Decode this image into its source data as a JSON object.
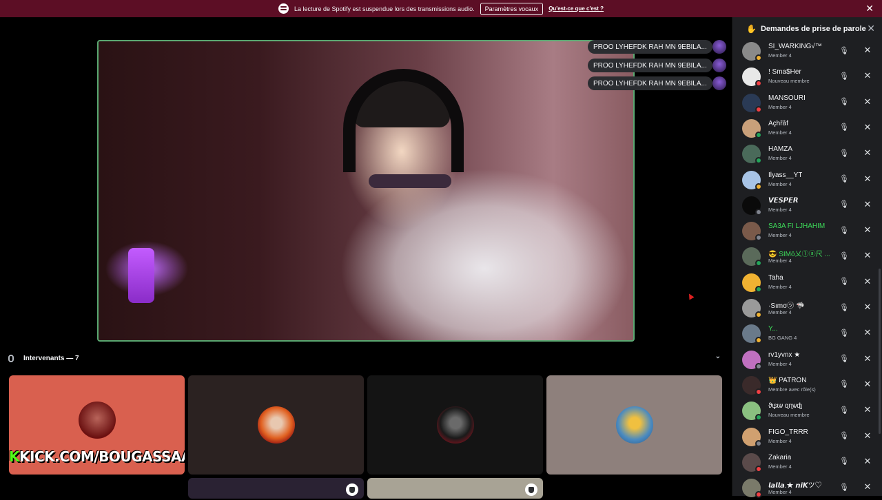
{
  "notice": {
    "message": "La lecture de Spotify est suspendue lors des transmissions audio.",
    "button_label": "Paramètres vocaux",
    "link_label": "Qu'est-ce que c'est ?",
    "close_glyph": "✕"
  },
  "stage": {
    "chat_messages": [
      "PROO LYHEFDK RAH MN 9EBILA...",
      "PROO LYHEFDK RAH MN 9EBILA...",
      "PROO LYHEFDK RAH MN 9EBILA..."
    ],
    "speakers_label": "Intervenants — 7",
    "chevron_glyph": "⌄",
    "kick_banner_k": "K",
    "kick_banner_text": "KICK.COM/BOUGASSAA"
  },
  "sidebar": {
    "title": "Demandes de prise de parole",
    "close_glyph": "✕",
    "accept_glyph": "🎙",
    "deny_glyph": "✕",
    "requests": [
      {
        "name": "SI_WARKING√™",
        "role": "Member 4",
        "status": "idle",
        "name_color": "#f2f3f5",
        "avatar": "#8a8a8a"
      },
      {
        "name": "! Sma$Her",
        "role": "Nouveau membre",
        "status": "dnd",
        "name_color": "#f2f3f5",
        "avatar": "#e8e8e8"
      },
      {
        "name": "MANSOURI",
        "role": "Member 4",
        "status": "dnd",
        "name_color": "#f2f3f5",
        "avatar": "#2a3a55"
      },
      {
        "name": "Açhřâf",
        "role": "Member 4",
        "status": "online",
        "name_color": "#f2f3f5",
        "avatar": "#c9a07a"
      },
      {
        "name": "HAMZA",
        "role": "Member 4",
        "status": "online",
        "name_color": "#f2f3f5",
        "avatar": "#4a6a5a"
      },
      {
        "name": "Ilyass__YT",
        "role": "Member 4",
        "status": "idle",
        "name_color": "#f2f3f5",
        "avatar": "#a8c4e6"
      },
      {
        "name": "𝙑𝙀𝙎𝙋𝙀𝙍",
        "role": "Member 4",
        "status": "offline",
        "name_color": "#f2f3f5",
        "avatar": "#0a0a0a"
      },
      {
        "name": "SA3A FI LJHAHIM",
        "role": "Member 4",
        "status": "offline",
        "name_color": "#3ddc5a",
        "avatar": "#7a5a4a"
      },
      {
        "name": "😎 SIMō乂①ⓐ尺 ...",
        "role": "Member 4",
        "status": "online",
        "name_color": "#3ddc5a",
        "avatar": "#5a6a5a"
      },
      {
        "name": "Taha",
        "role": "Member 4",
        "status": "mobile",
        "name_color": "#f2f3f5",
        "avatar": "#f0b232"
      },
      {
        "name": "·Sımσ㋡ 🦈",
        "role": "Member 4",
        "status": "idle",
        "name_color": "#f2f3f5",
        "avatar": "#9a9a9a"
      },
      {
        "name": "Y...",
        "role": "BG GANG 4",
        "status": "idle",
        "name_color": "#3ddc5a",
        "avatar": "#6a7a8a"
      },
      {
        "name": "rv1yvnx ★",
        "role": "Member 4",
        "status": "offline",
        "name_color": "#f2f3f5",
        "avatar": "#c070c0"
      },
      {
        "name": "👑 PATRON",
        "role": "Membre avec rôle(s)",
        "status": "dnd",
        "name_color": "#f2f3f5",
        "avatar": "#3a2a2a"
      },
      {
        "name": "ϑɩʂɩѡ ɋɳѡɖʅ",
        "role": "Nouveau membre",
        "status": "online",
        "name_color": "#f2f3f5",
        "avatar": "#8ac080"
      },
      {
        "name": "FIGO_TRRR",
        "role": "Member 4",
        "status": "offline",
        "name_color": "#f2f3f5",
        "avatar": "#d0a070"
      },
      {
        "name": "Zakaria",
        "role": "Member 4",
        "status": "dnd",
        "name_color": "#f2f3f5",
        "avatar": "#5a4a4a"
      },
      {
        "name": "𝙡𝙖𝙡𝙡𝙖.★ 𝙣𝙞𝙆ツ♡",
        "role": "Member 4",
        "status": "dnd",
        "name_color": "#f2f3f5",
        "avatar": "#7a7a6a"
      }
    ]
  },
  "colors": {
    "online": "#23a55a",
    "idle": "#f0b232",
    "dnd": "#f23f43",
    "offline": "#80848e",
    "mobile": "#23a55a"
  }
}
